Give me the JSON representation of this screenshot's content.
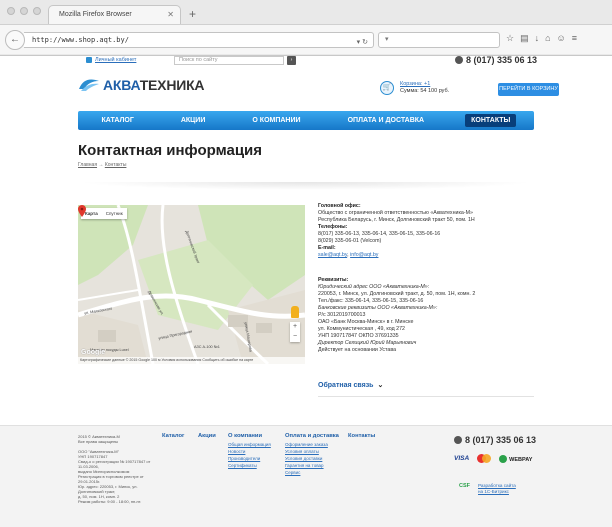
{
  "browser": {
    "tab_title": "Mozilla Firefox Browser",
    "url": "http://www.shop.aqt.by/",
    "search_placeholder": ""
  },
  "topbar": {
    "cabinet_link": "Личный кабинет",
    "search_placeholder": "Поиск по сайту",
    "phone": "8 (017) 335 06 13"
  },
  "logo": {
    "part1": "АКВА",
    "part2": "ТЕХНИКА"
  },
  "cart": {
    "link": "Корзина: +1",
    "sum": "Сумма: 54 100 руб.",
    "button": "ПЕРЕЙТИ В КОРЗИНУ"
  },
  "menu": [
    "КАТАЛОГ",
    "АКЦИИ",
    "О КОМПАНИИ",
    "ОПЛАТА И ДОСТАВКА",
    "КОНТАКТЫ"
  ],
  "page": {
    "title": "Контактная информация",
    "crumb_home": "Главная",
    "crumb_sep": "→",
    "crumb_current": "Контакты"
  },
  "map": {
    "type_map": "Карта",
    "type_sat": "Спутник",
    "google": "Google",
    "labels": {
      "street1": "Дражинская ул.",
      "street2": "Долгиновский тракт",
      "street3": "улица Машерова",
      "street4": "улица Пригородная",
      "street5": "АЗС А-100 №1",
      "street6": "Магазин посуды Luxel",
      "street7": "ул. Маяковского"
    },
    "footer": "Картографические данные © 2015 Google    100 м          Условия использования    Сообщить об ошибке на карте"
  },
  "contacts": {
    "office_h": "Головной офис:",
    "office_1": "Общество с ограниченной ответственностью «Акватехника-М»",
    "office_2": "Республика Беларусь, г. Минск, Долгиновский тракт 50, пом. 1Н",
    "phones_h": "Телефоны:",
    "phone_1": "8(017) 335-06-13, 335-06-14, 335-06-15, 335-06-16",
    "phone_2": "8(029) 335-06-01 (Velcom)",
    "email_h": "E-mail:",
    "email_1": "sale@aqt.by",
    "email_sep": ", ",
    "email_2": "info@aqt.by",
    "req_h": "Реквизиты:",
    "req_1": "Юридический адрес ООО «Акватехника-М»:",
    "req_2": "220053, г. Минск, ул. Долгиновский тракт, д. 50, пом. 1Н, комн. 2",
    "req_3": "Тел./факс: 335-06-14, 335-06-15, 335-06-16",
    "req_4": "Банковские реквизиты ООО «Акватехника-М»:",
    "req_5": "Р/с 3012019700013",
    "req_6": "ОАО «Банк Москва-Минск» в г. Минске",
    "req_7": "ул. Коммунистическая , 49, код 272",
    "req_8": "УНП 190717847   ОКПО 37691335",
    "req_9": "Директор Селицкий Юрий Марьянович",
    "req_10": "Действует на основании Устава",
    "feedback": "Обратная связь"
  },
  "footer": {
    "copyright": [
      "2015 © Акватехника-М",
      "Все права защищены",
      "",
      "ООО \"Акватехника-М\"",
      "УНП 190717847",
      "Свид-о о регистрации № 190717847 от 11.03.2006,",
      "выдано Мингорисполкомом",
      "Регистрация в торговом реестре от 29.01.2015г.",
      "Юр. адрес: 220053, г. Минск, ул. Долгиновский тракт,",
      "д. 50, пом. 1Н, комн. 2",
      "Режим работы: 9:00 - 18:00, пн-пт."
    ],
    "col_catalog": "Каталог",
    "col_actions": "Акции",
    "col_about": "О компании",
    "about_links": [
      "Общая информация",
      "Новости",
      "Производители",
      "Сертификаты"
    ],
    "col_delivery": "Оплата и доставка",
    "delivery_links": [
      "Оформление заказа",
      "Условия оплаты",
      "Условия доставки",
      "Гарантия на товар",
      "Сервис"
    ],
    "col_contacts": "Контакты",
    "phone": "8 (017) 335 06 13",
    "visa": "VISA",
    "webpay": "WEBPAY",
    "csf": "CSF",
    "dev_1": "Разработка сайта",
    "dev_2": "на 1С-Битрикс"
  }
}
